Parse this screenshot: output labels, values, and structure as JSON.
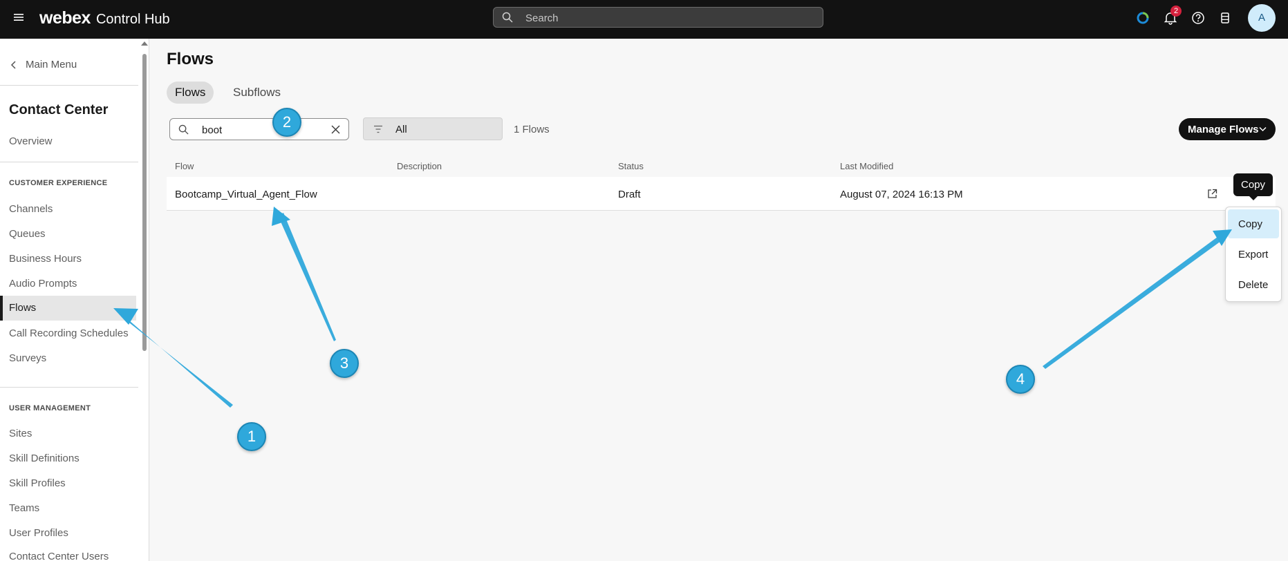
{
  "header": {
    "brand_logo": "webex",
    "brand_product": "Control Hub",
    "search_placeholder": "Search",
    "notification_count": "2",
    "avatar_initial": "A"
  },
  "sidebar": {
    "back_label": "Main Menu",
    "title": "Contact Center",
    "overview": "Overview",
    "section_customer_experience": "CUSTOMER EXPERIENCE",
    "cx_items": [
      "Channels",
      "Queues",
      "Business Hours",
      "Audio Prompts",
      "Flows",
      "Call Recording Schedules",
      "Surveys"
    ],
    "active_item": "Flows",
    "section_user_management": "USER MANAGEMENT",
    "um_items": [
      "Sites",
      "Skill Definitions",
      "Skill Profiles",
      "Teams",
      "User Profiles",
      "Contact Center Users"
    ]
  },
  "main": {
    "page_title": "Flows",
    "tabs": [
      {
        "label": "Flows",
        "active": true
      },
      {
        "label": "Subflows",
        "active": false
      }
    ],
    "search_value": "boot",
    "status_filter": "All",
    "flow_count": "1 Flows",
    "manage_button": "Manage Flows",
    "table": {
      "headers": [
        "Flow",
        "Description",
        "Status",
        "Last Modified"
      ],
      "rows": [
        {
          "flow": "Bootcamp_Virtual_Agent_Flow",
          "description": "",
          "status": "Draft",
          "last_modified": "August 07, 2024 16:13 PM"
        }
      ]
    },
    "tooltip": "Copy",
    "row_menu": [
      "Copy",
      "Export",
      "Delete"
    ]
  },
  "annotations": {
    "callouts": [
      "1",
      "2",
      "3",
      "4"
    ],
    "color": "#2fa8db"
  },
  "colors": {
    "topbar": "#121212",
    "accent_highlight": "#d6eefb",
    "badge": "#d4213d"
  }
}
